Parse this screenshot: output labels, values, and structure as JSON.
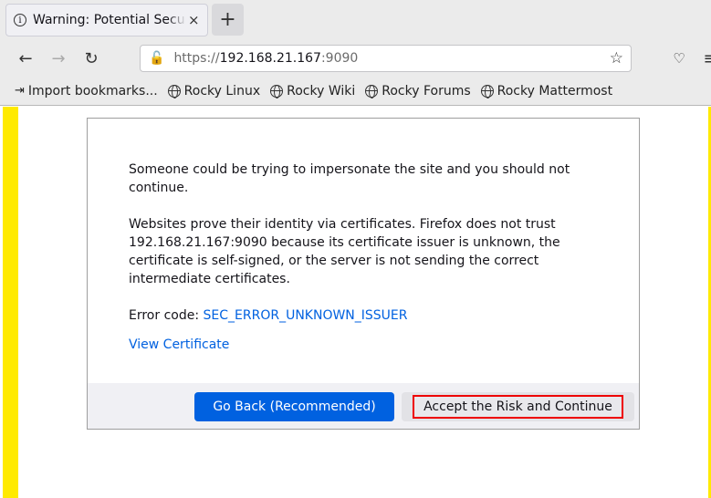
{
  "tabs": [
    {
      "title": "Warning: Potential Security Risk Ahead",
      "icon": "info-icon"
    }
  ],
  "toolbar": {
    "url_scheme": "https://",
    "url_host": "192.168.21.167",
    "url_port": ":9090"
  },
  "bookmarks": [
    {
      "label": "Import bookmarks...",
      "icon": "import-icon"
    },
    {
      "label": "Rocky Linux",
      "icon": "globe-icon"
    },
    {
      "label": "Rocky Wiki",
      "icon": "globe-icon"
    },
    {
      "label": "Rocky Forums",
      "icon": "globe-icon"
    },
    {
      "label": "Rocky Mattermost",
      "icon": "globe-icon"
    }
  ],
  "page": {
    "intro": "Someone could be trying to impersonate the site and you should not continue.",
    "explanation": "Websites prove their identity via certificates. Firefox does not trust 192.168.21.167:9090 because its certificate issuer is unknown, the certificate is self-signed, or the server is not sending the correct intermediate certificates.",
    "error_label": "Error code: ",
    "error_code": "SEC_ERROR_UNKNOWN_ISSUER",
    "view_certificate": "View Certificate",
    "go_back": "Go Back (Recommended)",
    "accept_risk": "Accept the Risk and Continue"
  },
  "colors": {
    "accent": "#0061e0",
    "highlight_border": "#ee0000",
    "side_band": "#ffea00"
  }
}
